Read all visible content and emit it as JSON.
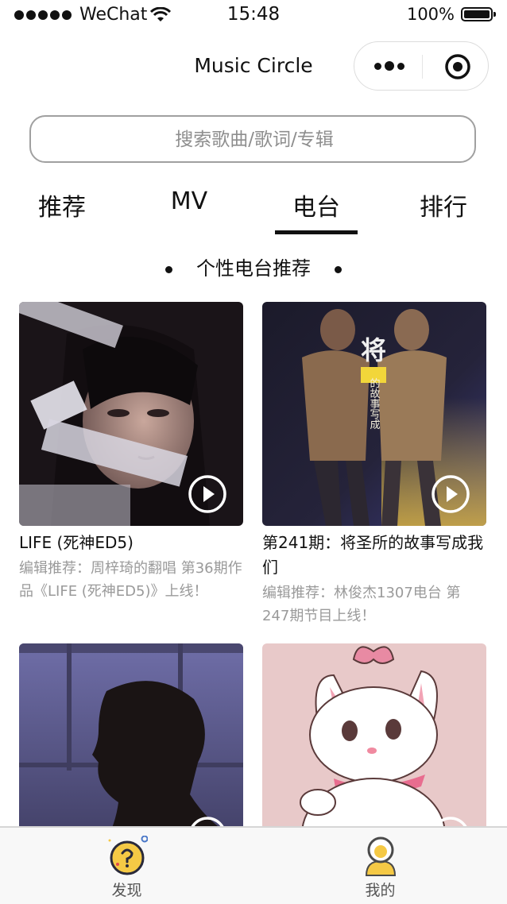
{
  "status_bar": {
    "carrier": "WeChat",
    "time": "15:48",
    "battery": "100%"
  },
  "nav": {
    "title": "Music Circle"
  },
  "search": {
    "placeholder": "搜索歌曲/歌词/专辑"
  },
  "tabs": [
    {
      "label": "推荐",
      "active": false
    },
    {
      "label": "MV",
      "active": false
    },
    {
      "label": "电台",
      "active": true
    },
    {
      "label": "排行",
      "active": false
    }
  ],
  "section": {
    "title": "个性电台推荐"
  },
  "cards": [
    {
      "title": "LIFE (死神ED5)",
      "desc": "编辑推荐：周梓琦的翻唱 第36期作品《LIFE (死神ED5)》上线！"
    },
    {
      "title": "第241期：将圣所的故事写成我们",
      "desc": "编辑推荐：林俊杰1307电台 第247期节目上线！"
    },
    {
      "title": "",
      "desc": ""
    },
    {
      "title": "",
      "desc": ""
    }
  ],
  "cover_text": {
    "big_char": "将",
    "caption": "的故事写成"
  },
  "tabbar": [
    {
      "label": "发现",
      "icon": "compass-icon",
      "active": true
    },
    {
      "label": "我的",
      "icon": "user-icon",
      "active": false
    }
  ],
  "colors": {
    "accent_yellow": "#f5c945",
    "text": "#111111",
    "muted": "#9a9a9a"
  }
}
